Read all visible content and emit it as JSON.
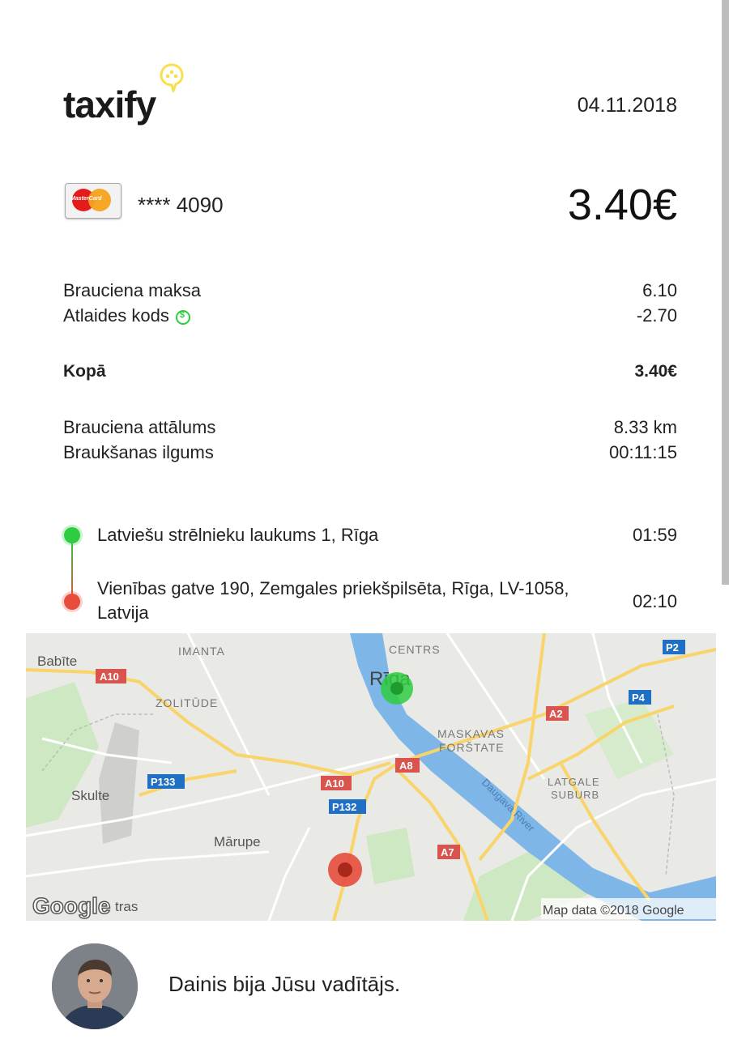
{
  "brand": {
    "name": "taxify",
    "accent": "#f7e04a"
  },
  "header": {
    "date": "04.11.2018"
  },
  "payment": {
    "card_icon": "mastercard-icon",
    "card_brand_text": "MasterCard",
    "card_masked": "**** 4090",
    "total_display": "3.40€"
  },
  "fare": {
    "ride_fee_label": "Brauciena maksa",
    "ride_fee_value": "6.10",
    "discount_label": "Atlaides kods",
    "discount_value": "-2.70",
    "total_label": "Kopā",
    "total_value": "3.40€"
  },
  "trip": {
    "distance_label": "Brauciena attālums",
    "distance_value": "8.33 km",
    "duration_label": "Braukšanas ilgums",
    "duration_value": "00:11:15"
  },
  "route": {
    "pickup": {
      "address": "Latviešu strēlnieku laukums 1, Rīga",
      "time": "01:59",
      "color": "#2ecc40"
    },
    "dropoff": {
      "address_line1": "Vienības gatve 190, Zemgales priekšpilsēta, Rīga, LV-1058,",
      "address_line2": "Latvija",
      "time": "02:10",
      "color": "#e74c3c"
    }
  },
  "map": {
    "labels": {
      "babite": "Babīte",
      "imanta": "IMANTA",
      "centrs": "CENTRS",
      "riga": "Rīga",
      "zolitude": "ZOLITŪDE",
      "maskavas1": "MASKAVAS",
      "maskavas2": "FORŠTATE",
      "latgale1": "LATGALE",
      "latgale2": "SUBURB",
      "skulte": "Skulte",
      "marupe": "Mārupe",
      "daugava": "Daugava River",
      "stras": "tras"
    },
    "shields": {
      "a10": "A10",
      "a10b": "A10",
      "a8": "A8",
      "a2": "A2",
      "a7": "A7",
      "p2": "P2",
      "p4": "P4",
      "p133": "P133",
      "p132": "P132"
    },
    "attribution_logo": "Google",
    "attribution": "Map data ©2018 Google"
  },
  "driver": {
    "message": "Dainis bija Jūsu vadītājs."
  }
}
